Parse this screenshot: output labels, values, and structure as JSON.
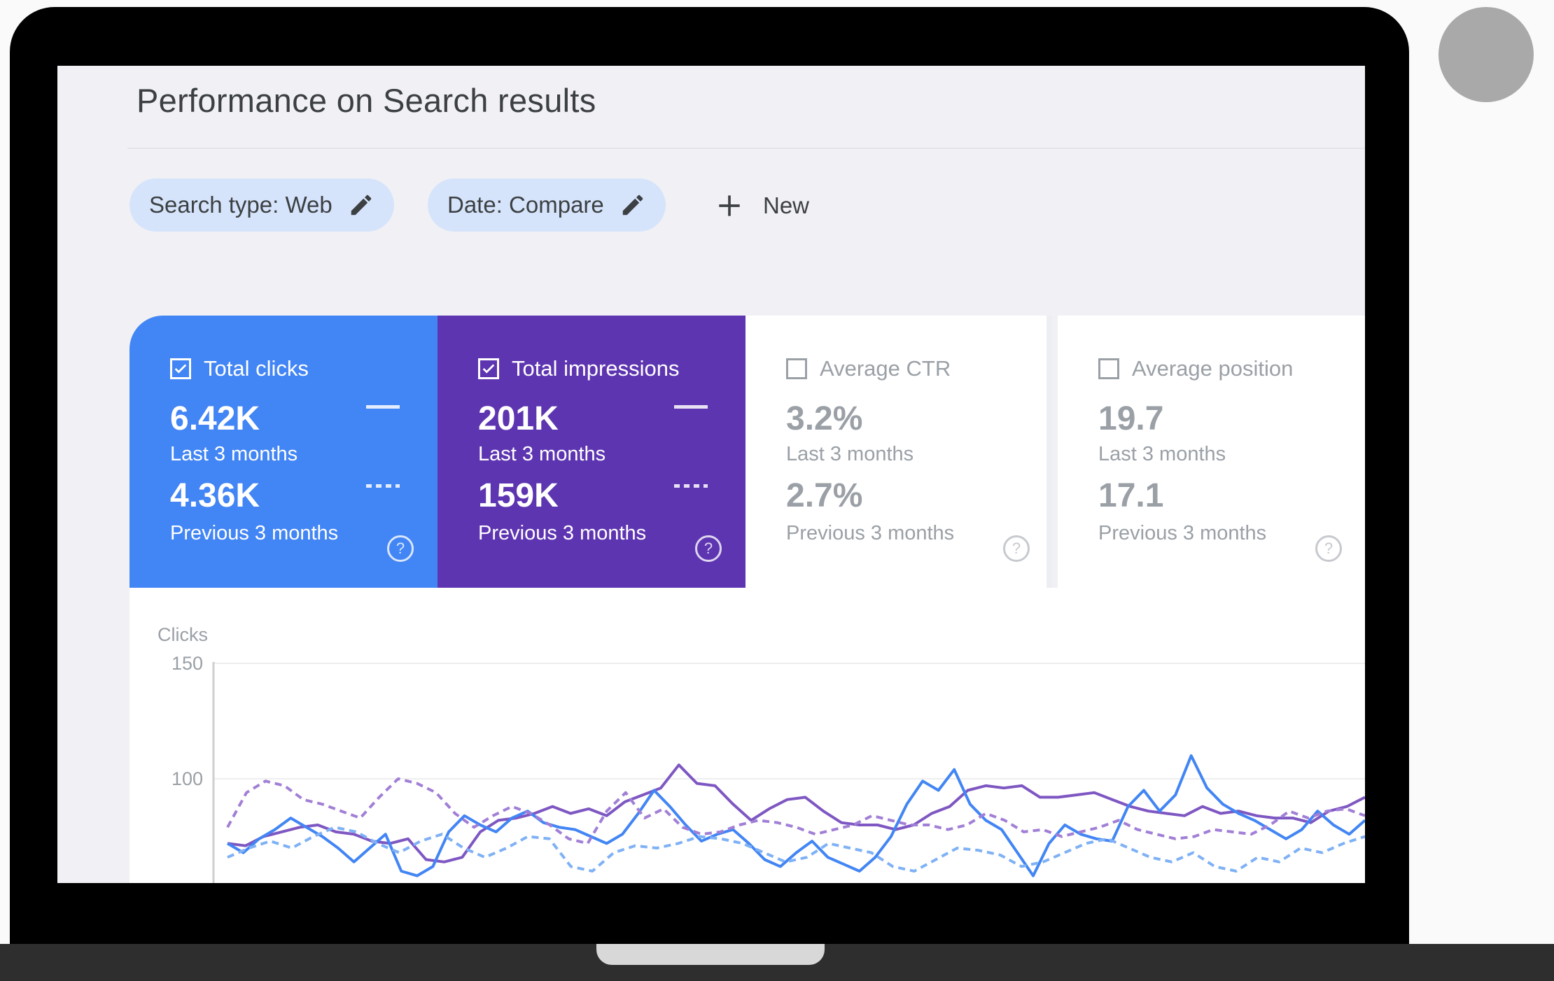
{
  "page": {
    "title": "Performance on Search results"
  },
  "filters": {
    "chips": [
      {
        "label": "Search type: Web",
        "icon": "pencil-icon"
      },
      {
        "label": "Date: Compare",
        "icon": "pencil-icon"
      }
    ],
    "new_label": "New"
  },
  "metrics": [
    {
      "label": "Total clicks",
      "checked": true,
      "current": "6.42K",
      "current_period": "Last 3 months",
      "previous": "4.36K",
      "previous_period": "Previous 3 months",
      "color": "#4285f4"
    },
    {
      "label": "Total impressions",
      "checked": true,
      "current": "201K",
      "current_period": "Last 3 months",
      "previous": "159K",
      "previous_period": "Previous 3 months",
      "color": "#5e35b1"
    },
    {
      "label": "Average CTR",
      "checked": false,
      "current": "3.2%",
      "current_period": "Last 3 months",
      "previous": "2.7%",
      "previous_period": "Previous 3 months",
      "color": "#ffffff"
    },
    {
      "label": "Average position",
      "checked": false,
      "current": "19.7",
      "current_period": "Last 3 months",
      "previous": "17.1",
      "previous_period": "Previous 3 months",
      "color": "#ffffff"
    }
  ],
  "chart_data": {
    "type": "line",
    "ylabel": "Clicks",
    "ylim": [
      50,
      150
    ],
    "yticks": [
      150,
      100
    ],
    "grid": true,
    "x": [
      1,
      2,
      3,
      4,
      5,
      6,
      7,
      8,
      9,
      10,
      11,
      12,
      13,
      14,
      15,
      16,
      17,
      18,
      19,
      20,
      21,
      22,
      23,
      24,
      25,
      26,
      27,
      28,
      29,
      30,
      31,
      32,
      33,
      34,
      35,
      36,
      37,
      38,
      39,
      40,
      41,
      42,
      43,
      44,
      45,
      46,
      47,
      48,
      49,
      50,
      51,
      52,
      53,
      54,
      55
    ],
    "series": [
      {
        "style": "solid",
        "color": "#7e57c2",
        "values": [
          72,
          71,
          75,
          77,
          79,
          80,
          77,
          76,
          73,
          72,
          74,
          65,
          64,
          66,
          77,
          82,
          83,
          85,
          88,
          85,
          87,
          84,
          90,
          93,
          96,
          106,
          98,
          97,
          89,
          82,
          87,
          91,
          92,
          86,
          81,
          80,
          80,
          78,
          80,
          85,
          88,
          95,
          97,
          96,
          97,
          92,
          92,
          93,
          94,
          91,
          88,
          86,
          85,
          84,
          88,
          85,
          86,
          84,
          83,
          83,
          81,
          86,
          88,
          92
        ]
      },
      {
        "style": "solid",
        "color": "#4285f4",
        "values": [
          72,
          68,
          74,
          78,
          83,
          79,
          75,
          70,
          64,
          70,
          76,
          60,
          58,
          62,
          77,
          84,
          80,
          77,
          83,
          86,
          81,
          79,
          78,
          75,
          72,
          76,
          85,
          95,
          88,
          80,
          73,
          76,
          78,
          72,
          65,
          62,
          68,
          73,
          66,
          63,
          60,
          66,
          75,
          89,
          99,
          95,
          104,
          89,
          82,
          78,
          68,
          58,
          72,
          80,
          76,
          74,
          73,
          88,
          95,
          86,
          93,
          110,
          96,
          89,
          85,
          82,
          78,
          74,
          78,
          86,
          80,
          76,
          82
        ]
      },
      {
        "style": "dashed",
        "color": "#a17fd6",
        "values": [
          79,
          94,
          99,
          97,
          91,
          89,
          86,
          83,
          92,
          100,
          98,
          94,
          85,
          79,
          84,
          88,
          85,
          80,
          74,
          72,
          86,
          94,
          83,
          87,
          79,
          76,
          77,
          80,
          82,
          81,
          79,
          76,
          78,
          80,
          84,
          82,
          80,
          80,
          78,
          80,
          85,
          82,
          77,
          78,
          75,
          77,
          79,
          82,
          78,
          76,
          74,
          75,
          78,
          77,
          76,
          80,
          86,
          83,
          86,
          87,
          84
        ]
      },
      {
        "style": "dashed",
        "color": "#7fb1f5",
        "values": [
          66,
          70,
          73,
          70,
          75,
          79,
          77,
          72,
          68,
          73,
          76,
          70,
          66,
          70,
          75,
          74,
          62,
          60,
          68,
          71,
          70,
          72,
          75,
          74,
          72,
          68,
          64,
          66,
          72,
          70,
          68,
          62,
          60,
          65,
          70,
          69,
          67,
          62,
          64,
          68,
          72,
          74,
          70,
          66,
          64,
          68,
          62,
          60,
          66,
          64,
          70,
          68,
          72,
          75
        ]
      }
    ]
  }
}
